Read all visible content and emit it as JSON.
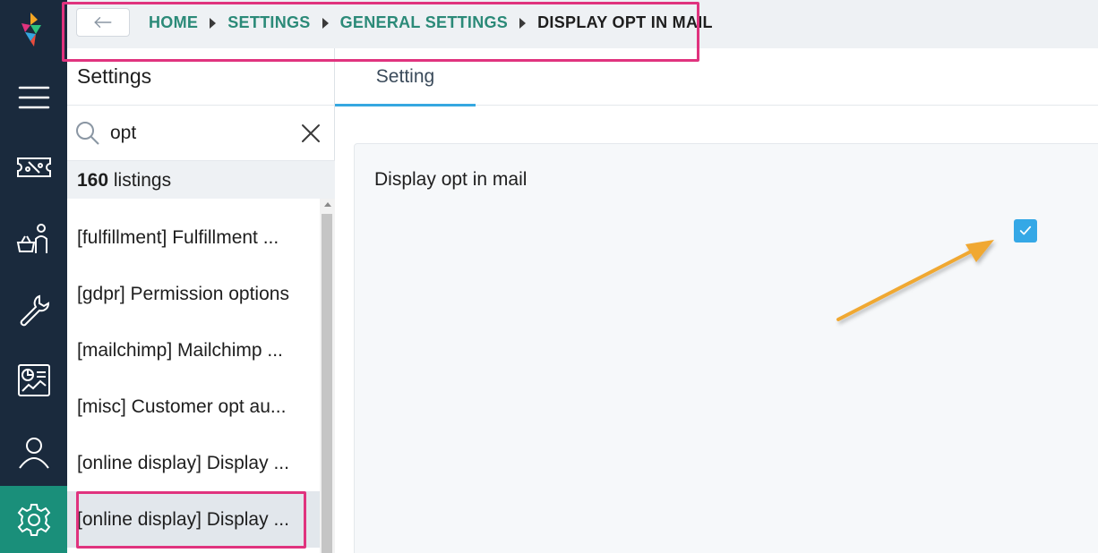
{
  "nav": {
    "items": [
      "menu",
      "tickets",
      "customers",
      "tools",
      "reports",
      "profile",
      "settings"
    ],
    "active": "settings",
    "active_color": "#1a8f7a"
  },
  "breadcrumb": {
    "items": [
      "HOME",
      "SETTINGS",
      "GENERAL SETTINGS"
    ],
    "current": "DISPLAY OPT IN MAIL",
    "link_color": "#2b8a78"
  },
  "settings_panel": {
    "title": "Settings",
    "search": {
      "value": "opt"
    },
    "count": "160",
    "count_label": "listings",
    "items": [
      "[fulfillment] Fulfillment ...",
      "[gdpr] Permission options",
      "[mailchimp] Mailchimp ...",
      "[misc] Customer opt au...",
      "[online display] Display ...",
      "[online display] Display ..."
    ],
    "selected_index": 5
  },
  "main": {
    "tabs": [
      "Setting"
    ],
    "active_tab": "Setting",
    "setting": {
      "label": "Display opt in mail",
      "checked": true,
      "checkbox_color": "#35a8e6"
    }
  },
  "annotations": {
    "highlight_color": "#e0337e",
    "arrow_color": "#f0a830"
  }
}
